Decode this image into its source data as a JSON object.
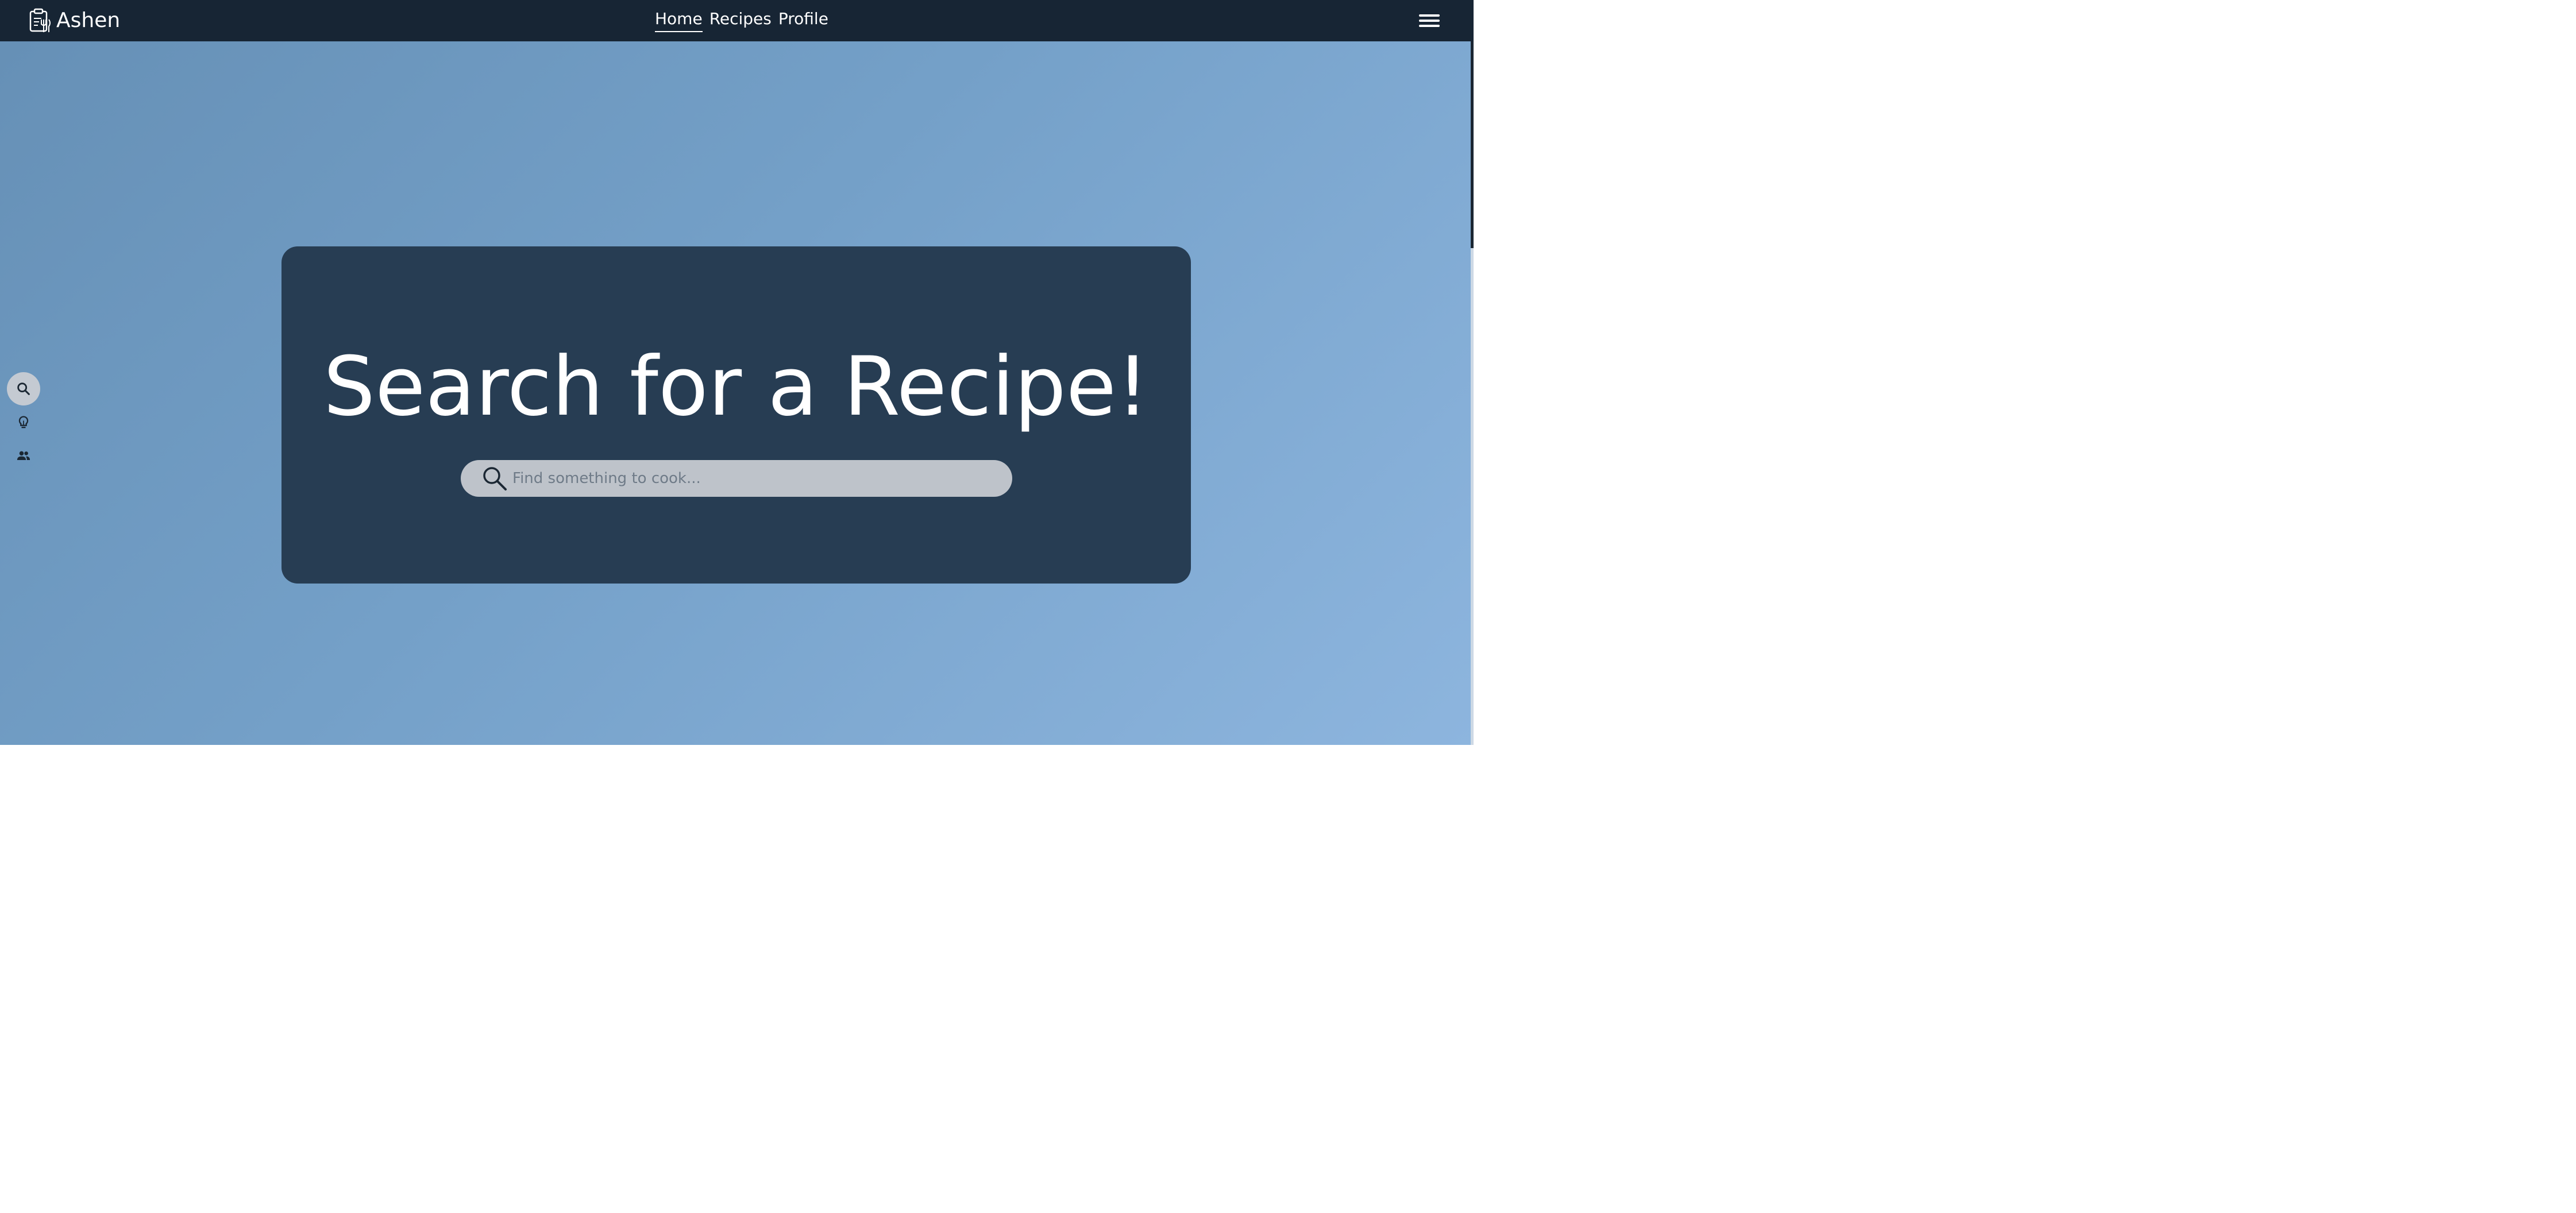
{
  "brand": {
    "name": "Ashen",
    "icon": "recipe-clipboard-icon"
  },
  "nav": {
    "links": [
      {
        "label": "Home",
        "active": true
      },
      {
        "label": "Recipes",
        "active": false
      },
      {
        "label": "Profile",
        "active": false
      }
    ],
    "menu_icon": "hamburger-menu-icon"
  },
  "side_rail": {
    "items": [
      {
        "icon": "search-icon",
        "active": true
      },
      {
        "icon": "lightbulb-icon",
        "active": false
      },
      {
        "icon": "people-icon",
        "active": false
      }
    ]
  },
  "hero": {
    "title": "Search for a Recipe!",
    "search": {
      "value": "",
      "placeholder": "Find something to cook..."
    }
  },
  "colors": {
    "navbar": "#172534",
    "card": "#273d53",
    "search_bar": "#bec3ca",
    "rail_active": "#c4cad2",
    "gradient_start": "#6690b6",
    "gradient_end": "#8db5de"
  }
}
